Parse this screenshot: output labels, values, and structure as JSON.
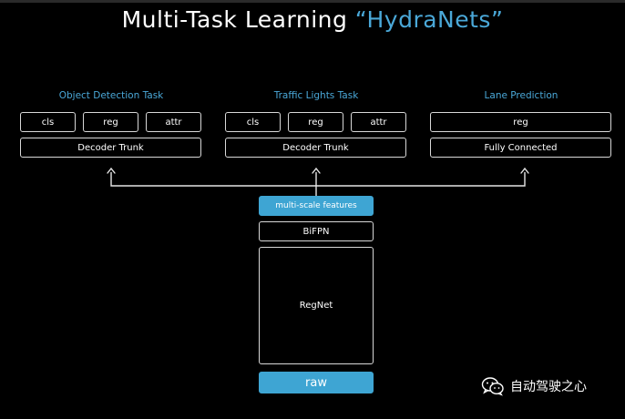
{
  "title": {
    "main": "Multi-Task Learning ",
    "accent": "“HydraNets”"
  },
  "tasks": [
    {
      "name": "Object Detection Task",
      "heads": [
        "cls",
        "reg",
        "attr"
      ],
      "trunk": "Decoder Trunk"
    },
    {
      "name": "Traffic Lights Task",
      "heads": [
        "cls",
        "reg",
        "attr"
      ],
      "trunk": "Decoder Trunk"
    },
    {
      "name": "Lane Prediction",
      "heads": [
        "reg"
      ],
      "trunk": "Fully Connected"
    }
  ],
  "backbone": {
    "features": "multi-scale features",
    "neck": "BiFPN",
    "net": "RegNet",
    "input": "raw"
  },
  "colors": {
    "accent": "#4aa8d8",
    "filled": "#3ea5d3",
    "background": "#000000"
  },
  "watermark": {
    "text": "自动驾驶之心",
    "icon": "wechat-icon"
  }
}
